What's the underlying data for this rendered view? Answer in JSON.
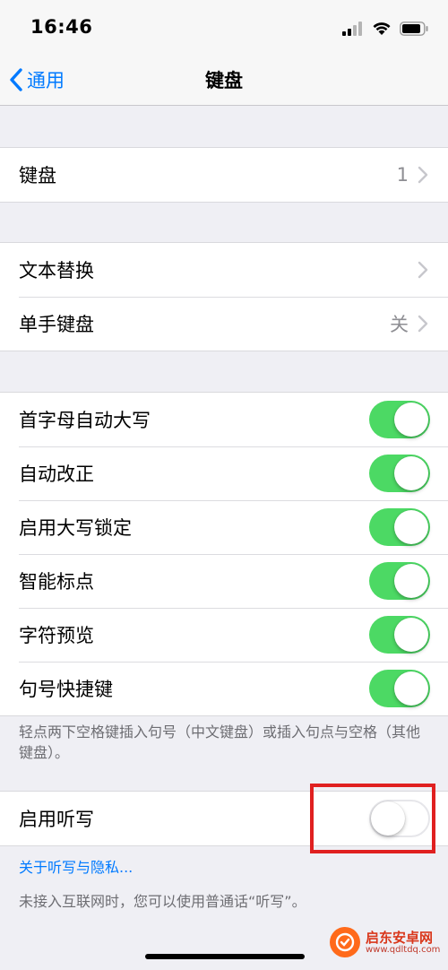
{
  "status_bar": {
    "time": "16:46"
  },
  "nav": {
    "back_label": "通用",
    "title": "键盘"
  },
  "group_keyboards": {
    "label": "键盘",
    "value": "1"
  },
  "group_text": {
    "items": [
      {
        "label": "文本替换",
        "value": ""
      },
      {
        "label": "单手键盘",
        "value": "关"
      }
    ]
  },
  "group_toggles": {
    "items": [
      {
        "label": "首字母自动大写",
        "state": "on"
      },
      {
        "label": "自动改正",
        "state": "on"
      },
      {
        "label": "启用大写锁定",
        "state": "on"
      },
      {
        "label": "智能标点",
        "state": "on"
      },
      {
        "label": "字符预览",
        "state": "on"
      },
      {
        "label": "句号快捷键",
        "state": "on"
      }
    ],
    "footnote": "轻点两下空格键插入句号（中文键盘）或插入句点与空格（其他键盘）。"
  },
  "dictation": {
    "label": "启用听写",
    "state": "off",
    "privacy_link": "关于听写与隐私...",
    "footnote": "未接入互联网时，您可以使用普通话“听写”。"
  },
  "watermark": {
    "name": "启东安卓网",
    "url": "www.qdltdq.com"
  },
  "colors": {
    "accent": "#007aff",
    "toggle_on": "#4cd964",
    "annotation": "#e02020"
  }
}
